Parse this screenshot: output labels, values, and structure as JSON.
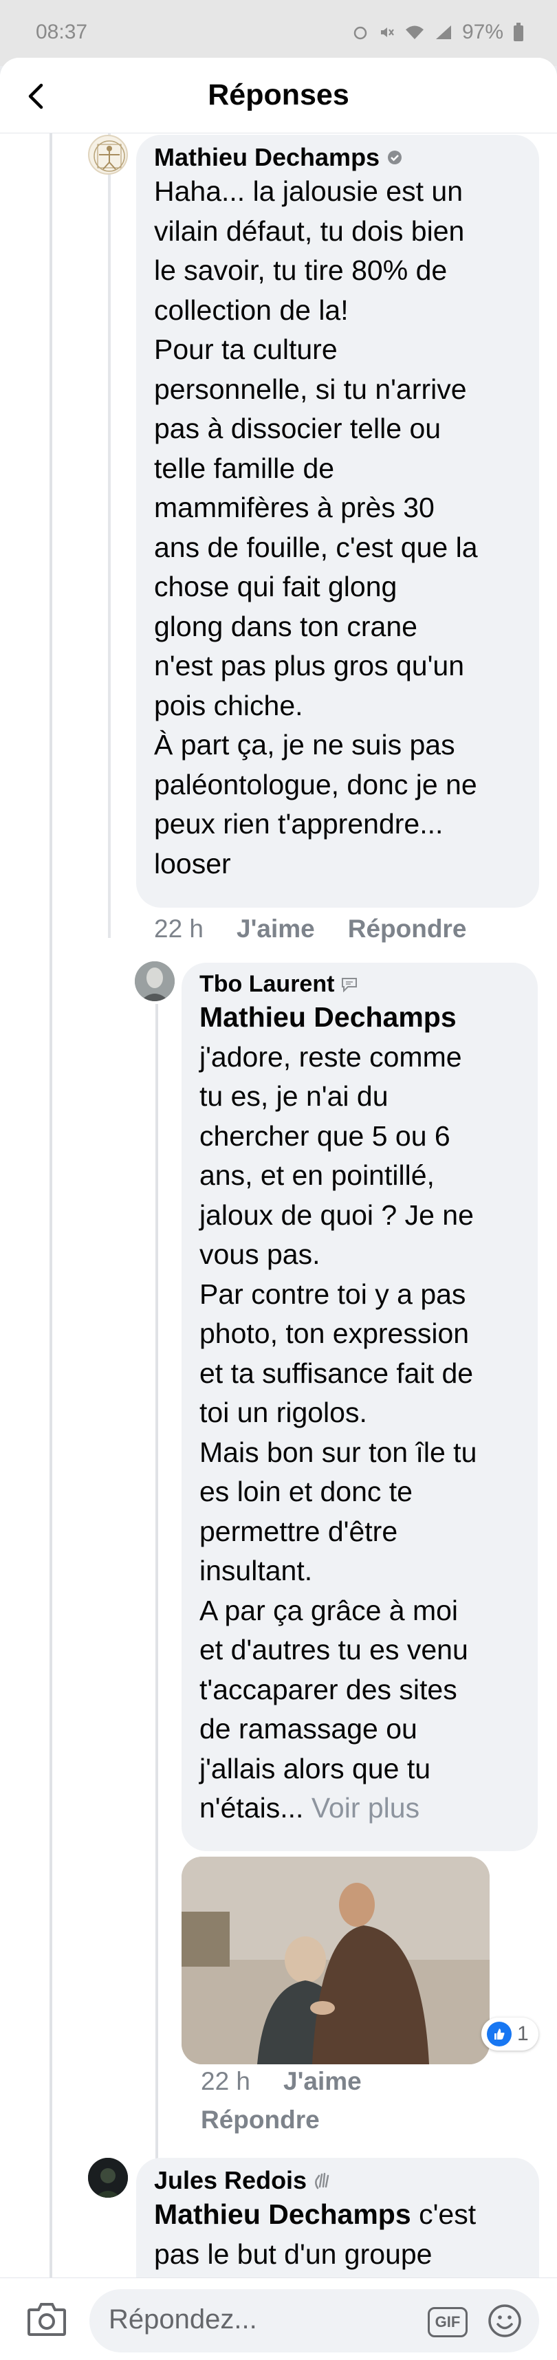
{
  "status_bar": {
    "time": "08:37",
    "battery": "97%"
  },
  "header": {
    "title": "Réponses"
  },
  "comments": [
    {
      "author": "Mathieu Dechamps",
      "badge": "verified-badge-icon",
      "text": "Haha... la jalousie est un\nvilain défaut, tu dois bien\nle savoir, tu tire 80% de\ncollection de la!\nPour ta culture\npersonnelle, si tu n'arrive\npas à dissocier telle ou\ntelle famille de\nmammifères à près 30\nans de fouille, c'est que la\nchose qui fait glong\nglong dans ton crane\nn'est pas plus gros qu'un\npois chiche.\nÀ part ça, je ne suis pas\npaléontologue, donc je ne\npeux rien t'apprendre...\nlooser",
      "time": "22 h",
      "like": "J'aime",
      "reply": "Répondre"
    },
    {
      "author": "Tbo Laurent",
      "badge": "conversation-starter-icon",
      "mention": "Mathieu Dechamps",
      "text": "j'adore, reste comme\ntu es, je n'ai du\nchercher que 5 ou 6\nans, et en pointillé,\njaloux de quoi ? Je ne\nvous pas.\nPar contre toi y a pas\nphoto, ton expression\net ta suffisance fait de\ntoi un rigolos.\nMais bon sur ton île tu\nes loin et donc te\npermettre d'être\ninsultant.\nA par ça  grâce à moi\net d'autres tu es venu\nt'accaparer des sites\nde ramassage ou\nj'allais alors que tu\nn'étais...",
      "see_more": "Voir plus",
      "reaction_count": "1",
      "time": "22 h",
      "like": "J'aime",
      "reply": "Répondre"
    },
    {
      "author": "Jules Redois",
      "badge": "wave-icon",
      "mention": "Mathieu Dechamps",
      "text": "c'est\npas le but d'un groupe"
    }
  ],
  "composer": {
    "placeholder": "Répondez...",
    "gif_label": "GIF"
  },
  "colors": {
    "bubble": "#f0f2f5",
    "meta": "#7d838b",
    "like_blue": "#1877f2"
  }
}
